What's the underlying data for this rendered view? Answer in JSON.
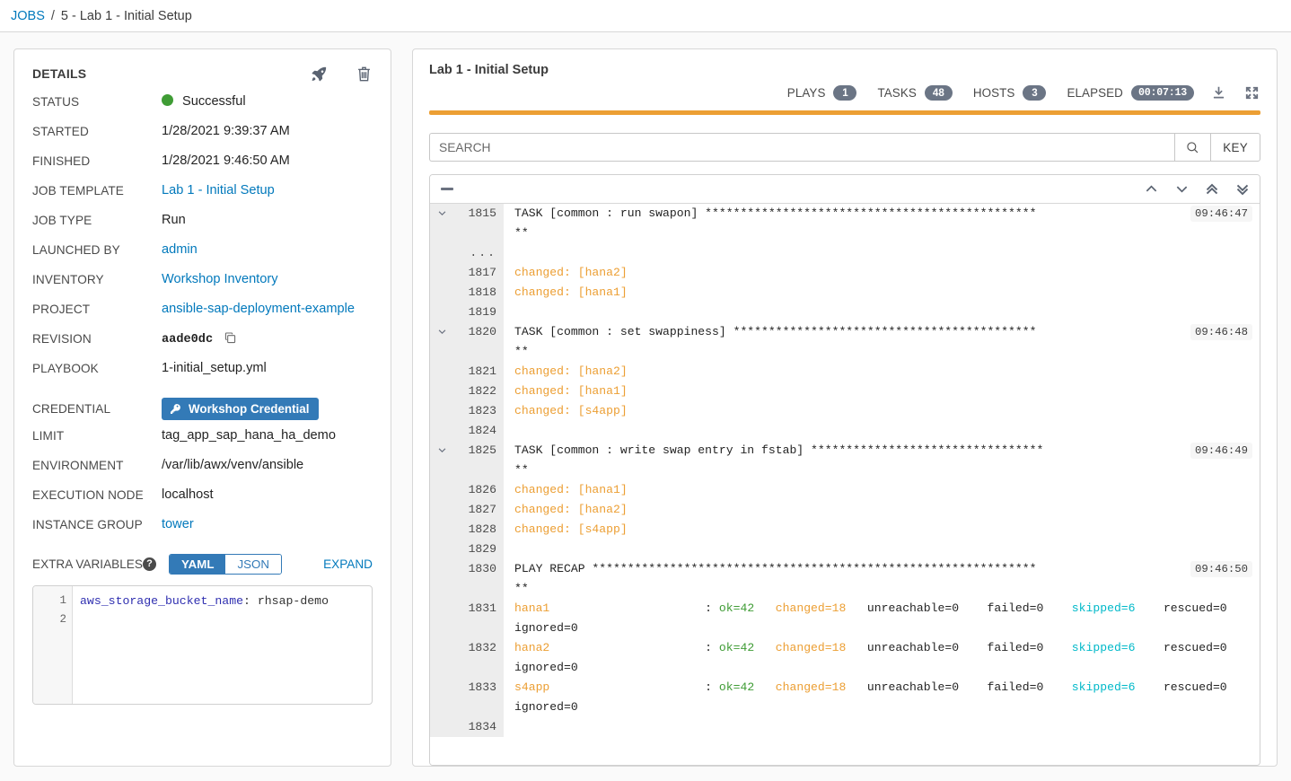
{
  "breadcrumb": {
    "root": "JOBS",
    "separator": "/",
    "current": "5 - Lab 1 - Initial Setup"
  },
  "details": {
    "title": "DETAILS",
    "actions": [
      {
        "name": "relaunch-button",
        "icon": "rocket-icon"
      },
      {
        "name": "delete-button",
        "icon": "trash-icon"
      }
    ],
    "fields": {
      "status_label": "STATUS",
      "status_value": "Successful",
      "status_color": "#3f9c35",
      "started_label": "STARTED",
      "started_value": "1/28/2021 9:39:37 AM",
      "finished_label": "FINISHED",
      "finished_value": "1/28/2021 9:46:50 AM",
      "job_template_label": "JOB TEMPLATE",
      "job_template_value": "Lab 1 - Initial Setup",
      "job_type_label": "JOB TYPE",
      "job_type_value": "Run",
      "launched_by_label": "LAUNCHED BY",
      "launched_by_value": "admin",
      "inventory_label": "INVENTORY",
      "inventory_value": "Workshop Inventory",
      "project_label": "PROJECT",
      "project_value": "ansible-sap-deployment-example",
      "revision_label": "REVISION",
      "revision_value": "aade0dc",
      "playbook_label": "PLAYBOOK",
      "playbook_value": "1-initial_setup.yml",
      "credential_label": "CREDENTIAL",
      "credential_value": "Workshop Credential",
      "limit_label": "LIMIT",
      "limit_value": "tag_app_sap_hana_ha_demo",
      "environment_label": "ENVIRONMENT",
      "environment_value": "/var/lib/awx/venv/ansible",
      "execution_node_label": "EXECUTION NODE",
      "execution_node_value": "localhost",
      "instance_group_label": "INSTANCE GROUP",
      "instance_group_value": "tower"
    },
    "extra_variables": {
      "label": "EXTRA VARIABLES",
      "help_icon": "question-mark-icon",
      "modes": [
        "YAML",
        "JSON"
      ],
      "active_mode": "YAML",
      "expand_label": "EXPAND",
      "line_numbers": [
        "1",
        "2"
      ],
      "code_key": "aws_storage_bucket_name",
      "code_rest": ": rhsap-demo"
    }
  },
  "output": {
    "title": "Lab 1 - Initial Setup",
    "stats": [
      {
        "label": "PLAYS",
        "value": "1"
      },
      {
        "label": "TASKS",
        "value": "48"
      },
      {
        "label": "HOSTS",
        "value": "3"
      },
      {
        "label": "ELAPSED",
        "value": "00:07:13"
      }
    ],
    "header_actions": [
      {
        "name": "download-output-button",
        "icon": "download-icon"
      },
      {
        "name": "expand-output-button",
        "icon": "expand-icon"
      }
    ],
    "progress_color": "#ec9f34",
    "search": {
      "placeholder": "SEARCH",
      "value": "",
      "submit_icon": "search-icon",
      "key_label": "KEY"
    },
    "toolbar": {
      "collapse_all": "collapse-all-toggle",
      "nav": [
        "scroll-up-icon",
        "scroll-down-icon",
        "scroll-top-icon",
        "scroll-bottom-icon"
      ]
    },
    "lines": [
      {
        "toggle": true,
        "num": "1815",
        "ts": "09:46:47",
        "segs": [
          {
            "t": "TASK [common : run swapon] ***********************************************\n**"
          }
        ]
      },
      {
        "toggle": false,
        "num": "...",
        "ts": "",
        "segs": [
          {
            "t": ""
          }
        ]
      },
      {
        "toggle": false,
        "num": "1817",
        "ts": "",
        "segs": [
          {
            "t": "changed: [hana2]",
            "c": "o"
          }
        ]
      },
      {
        "toggle": false,
        "num": "1818",
        "ts": "",
        "segs": [
          {
            "t": "changed: [hana1]",
            "c": "o"
          }
        ]
      },
      {
        "toggle": false,
        "num": "1819",
        "ts": "",
        "segs": [
          {
            "t": ""
          }
        ]
      },
      {
        "toggle": true,
        "num": "1820",
        "ts": "09:46:48",
        "segs": [
          {
            "t": "TASK [common : set swappiness] *******************************************\n**"
          }
        ]
      },
      {
        "toggle": false,
        "num": "1821",
        "ts": "",
        "segs": [
          {
            "t": "changed: [hana2]",
            "c": "o"
          }
        ]
      },
      {
        "toggle": false,
        "num": "1822",
        "ts": "",
        "segs": [
          {
            "t": "changed: [hana1]",
            "c": "o"
          }
        ]
      },
      {
        "toggle": false,
        "num": "1823",
        "ts": "",
        "segs": [
          {
            "t": "changed: [s4app]",
            "c": "o"
          }
        ]
      },
      {
        "toggle": false,
        "num": "1824",
        "ts": "",
        "segs": [
          {
            "t": ""
          }
        ]
      },
      {
        "toggle": true,
        "num": "1825",
        "ts": "09:46:49",
        "segs": [
          {
            "t": "TASK [common : write swap entry in fstab] *********************************\n**"
          }
        ]
      },
      {
        "toggle": false,
        "num": "1826",
        "ts": "",
        "segs": [
          {
            "t": "changed: [hana1]",
            "c": "o"
          }
        ]
      },
      {
        "toggle": false,
        "num": "1827",
        "ts": "",
        "segs": [
          {
            "t": "changed: [hana2]",
            "c": "o"
          }
        ]
      },
      {
        "toggle": false,
        "num": "1828",
        "ts": "",
        "segs": [
          {
            "t": "changed: [s4app]",
            "c": "o"
          }
        ]
      },
      {
        "toggle": false,
        "num": "1829",
        "ts": "",
        "segs": [
          {
            "t": ""
          }
        ]
      },
      {
        "toggle": false,
        "num": "1830",
        "ts": "09:46:50",
        "segs": [
          {
            "t": "PLAY RECAP ***************************************************************\n**"
          }
        ]
      },
      {
        "toggle": false,
        "num": "1831",
        "ts": "",
        "segs": [
          {
            "t": "hana1",
            "c": "o"
          },
          {
            "t": "                      : "
          },
          {
            "t": "ok=42",
            "c": "g"
          },
          {
            "t": "   "
          },
          {
            "t": "changed=18",
            "c": "o"
          },
          {
            "t": "   unreachable=0    failed=0    "
          },
          {
            "t": "skipped=6",
            "c": "c"
          },
          {
            "t": "    rescued=0    ignored=0"
          }
        ]
      },
      {
        "toggle": false,
        "num": "1832",
        "ts": "",
        "segs": [
          {
            "t": "hana2",
            "c": "o"
          },
          {
            "t": "                      : "
          },
          {
            "t": "ok=42",
            "c": "g"
          },
          {
            "t": "   "
          },
          {
            "t": "changed=18",
            "c": "o"
          },
          {
            "t": "   unreachable=0    failed=0    "
          },
          {
            "t": "skipped=6",
            "c": "c"
          },
          {
            "t": "    rescued=0    ignored=0"
          }
        ]
      },
      {
        "toggle": false,
        "num": "1833",
        "ts": "",
        "segs": [
          {
            "t": "s4app",
            "c": "o"
          },
          {
            "t": "                      : "
          },
          {
            "t": "ok=42",
            "c": "g"
          },
          {
            "t": "   "
          },
          {
            "t": "changed=18",
            "c": "o"
          },
          {
            "t": "   unreachable=0    failed=0    "
          },
          {
            "t": "skipped=6",
            "c": "c"
          },
          {
            "t": "    rescued=0    ignored=0"
          }
        ]
      },
      {
        "toggle": false,
        "num": "1834",
        "ts": "",
        "segs": [
          {
            "t": ""
          }
        ]
      }
    ]
  }
}
